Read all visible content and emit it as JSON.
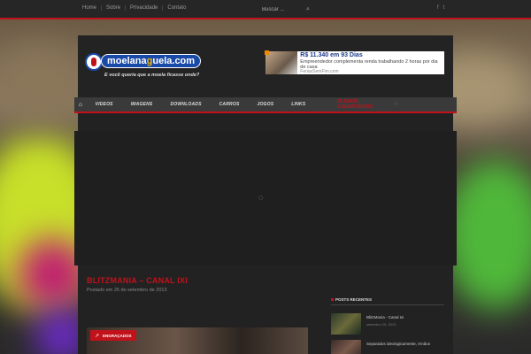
{
  "topbar": {
    "links": [
      "Home",
      "Sobre",
      "Privacidade",
      "Contato"
    ],
    "search_placeholder": "Buscar ...",
    "social": [
      "f",
      "t"
    ]
  },
  "header": {
    "logo_part1": "moelana",
    "logo_part2": "g",
    "logo_part3": "uela.com",
    "tagline": "E você queria que a moela ficasse onde?",
    "ad": {
      "title": "R$ 11.340 em 93 Dias",
      "line": "Empreendedor complementa renda trabalhando 2 horas por dia de casa",
      "source": "FeriasSemFim.com"
    }
  },
  "nav": {
    "items": [
      "VIDEOS",
      "IMAGENS",
      "DOWNLOADS",
      "CARROS",
      "JOGOS",
      "LINKS"
    ],
    "highlight": "ÚLTIMOS COMENTÁRIOS"
  },
  "post": {
    "title": "BLITZMANIA – CANAL IXI",
    "date": "Postado em 25 de setembro de 2013",
    "category": "ENGRAÇADOS"
  },
  "sidebar": {
    "title": "POSTS RECENTES",
    "items": [
      {
        "title": "BlitzMania - Canal Ixi",
        "date": "setembro 25, 2013"
      },
      {
        "title": "Separados ideologicamente, Irmãos",
        "date": ""
      }
    ]
  },
  "colors": {
    "accent": "#c1121b",
    "brand_blue": "#1a4aa8"
  }
}
